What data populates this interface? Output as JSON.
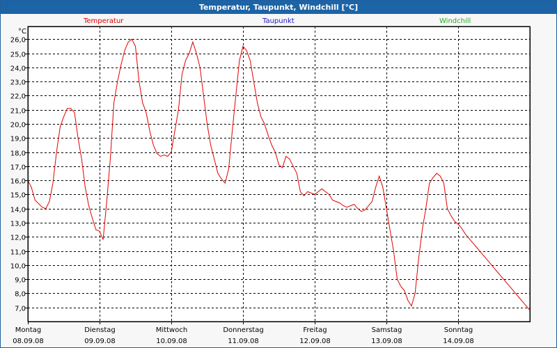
{
  "window": {
    "title": "Temperatur, Taupunkt, Windchill [°C]"
  },
  "legend": [
    {
      "label": "Temperatur",
      "color": "#e00000"
    },
    {
      "label": "Taupunkt",
      "color": "#1a1acc"
    },
    {
      "label": "Windchill",
      "color": "#20b020"
    }
  ],
  "chart_data": {
    "type": "line",
    "y_unit": "°C",
    "ylim": [
      6.0,
      26.9
    ],
    "yticks": [
      "26,0",
      "25,0",
      "24,0",
      "23,0",
      "22,0",
      "21,0",
      "20,0",
      "19,0",
      "18,0",
      "17,0",
      "16,0",
      "15,0",
      "14,0",
      "13,0",
      "12,0",
      "11,0",
      "10,0",
      "9,0",
      "8,0",
      "7,0"
    ],
    "ytick_values": [
      26,
      25,
      24,
      23,
      22,
      21,
      20,
      19,
      18,
      17,
      16,
      15,
      14,
      13,
      12,
      11,
      10,
      9,
      8,
      7
    ],
    "xlim": [
      0,
      7.0
    ],
    "xticks": [
      {
        "day": "Montag",
        "date": "08.09.08",
        "x": 0
      },
      {
        "day": "Dienstag",
        "date": "09.09.08",
        "x": 1
      },
      {
        "day": "Mittwoch",
        "date": "10.09.08",
        "x": 2
      },
      {
        "day": "Donnerstag",
        "date": "11.09.08",
        "x": 3
      },
      {
        "day": "Freitag",
        "date": "12.09.08",
        "x": 4
      },
      {
        "day": "Samstag",
        "date": "13.09.08",
        "x": 5
      },
      {
        "day": "Sonntag",
        "date": "14.09.08",
        "x": 6
      }
    ],
    "grid": true,
    "legend_position": "top",
    "series": [
      {
        "name": "Temperatur",
        "color": "#e00000",
        "x": [
          0.0,
          0.05,
          0.1,
          0.2,
          0.25,
          0.3,
          0.35,
          0.4,
          0.45,
          0.5,
          0.55,
          0.6,
          0.65,
          0.7,
          0.75,
          0.8,
          0.85,
          0.9,
          0.95,
          1.0,
          1.05,
          1.1,
          1.15,
          1.2,
          1.25,
          1.3,
          1.35,
          1.4,
          1.45,
          1.5,
          1.55,
          1.6,
          1.65,
          1.7,
          1.75,
          1.8,
          1.85,
          1.9,
          1.95,
          2.0,
          2.05,
          2.1,
          2.15,
          2.2,
          2.25,
          2.3,
          2.35,
          2.4,
          2.45,
          2.5,
          2.55,
          2.6,
          2.65,
          2.7,
          2.75,
          2.8,
          2.85,
          2.9,
          2.95,
          3.0,
          3.05,
          3.1,
          3.15,
          3.2,
          3.25,
          3.3,
          3.35,
          3.4,
          3.45,
          3.5,
          3.55,
          3.6,
          3.65,
          3.7,
          3.75,
          3.8,
          3.85,
          3.9,
          3.95,
          4.0,
          4.05,
          4.1,
          4.15,
          4.2,
          4.25,
          4.3,
          4.35,
          4.4,
          4.45,
          4.5,
          4.55,
          4.6,
          4.65,
          4.7,
          4.75,
          4.8,
          4.85,
          4.9,
          4.95,
          5.0,
          5.05,
          5.1,
          5.15,
          5.2,
          5.25,
          5.3,
          5.35,
          5.4,
          5.45,
          5.5,
          5.55,
          5.6,
          5.65,
          5.7,
          5.75,
          5.8,
          5.85,
          5.9,
          5.95,
          6.0,
          6.05,
          6.1,
          6.15,
          6.2,
          6.25,
          6.3,
          6.35,
          6.4,
          6.45,
          6.5,
          6.55,
          6.6,
          6.65,
          6.7,
          6.75,
          6.8,
          6.85,
          6.9,
          6.95,
          7.0
        ],
        "y": [
          16.0,
          15.5,
          14.6,
          14.1,
          14.0,
          14.5,
          15.8,
          18.0,
          19.8,
          20.5,
          21.1,
          21.1,
          20.8,
          19.0,
          17.5,
          15.5,
          14.2,
          13.3,
          12.5,
          12.4,
          11.8,
          14.5,
          17.5,
          21.5,
          23.0,
          24.2,
          25.2,
          25.8,
          26.0,
          25.5,
          23.0,
          21.5,
          20.8,
          19.5,
          18.5,
          17.9,
          17.7,
          17.8,
          17.7,
          18.0,
          19.5,
          21.0,
          23.5,
          24.5,
          25.0,
          25.8,
          25.0,
          24.0,
          22.0,
          20.0,
          18.5,
          17.5,
          16.5,
          16.1,
          15.8,
          16.8,
          19.5,
          22.0,
          24.5,
          25.5,
          25.2,
          24.5,
          23.0,
          21.5,
          20.5,
          20.0,
          19.2,
          18.5,
          18.0,
          17.1,
          16.9,
          17.7,
          17.5,
          17.0,
          16.5,
          15.2,
          14.9,
          15.2,
          15.1,
          15.0,
          15.2,
          15.4,
          15.2,
          15.0,
          14.6,
          14.5,
          14.4,
          14.2,
          14.1,
          14.2,
          14.3,
          14.0,
          13.8,
          13.9,
          14.2,
          14.5,
          15.5,
          16.3,
          15.5,
          14.0,
          12.5,
          11.0,
          9.0,
          8.5,
          8.2,
          7.5,
          7.1,
          8.0,
          10.5,
          12.5,
          14.0,
          15.8,
          16.2,
          16.5,
          16.3,
          15.8,
          14.0,
          13.5,
          13.1,
          12.9,
          12.6,
          12.2,
          11.9,
          11.6,
          11.3,
          11.0,
          10.7,
          10.4,
          10.1,
          9.8,
          9.5,
          9.2,
          8.9,
          8.6,
          8.3,
          8.0,
          7.7,
          7.4,
          7.1,
          6.8
        ]
      }
    ]
  }
}
